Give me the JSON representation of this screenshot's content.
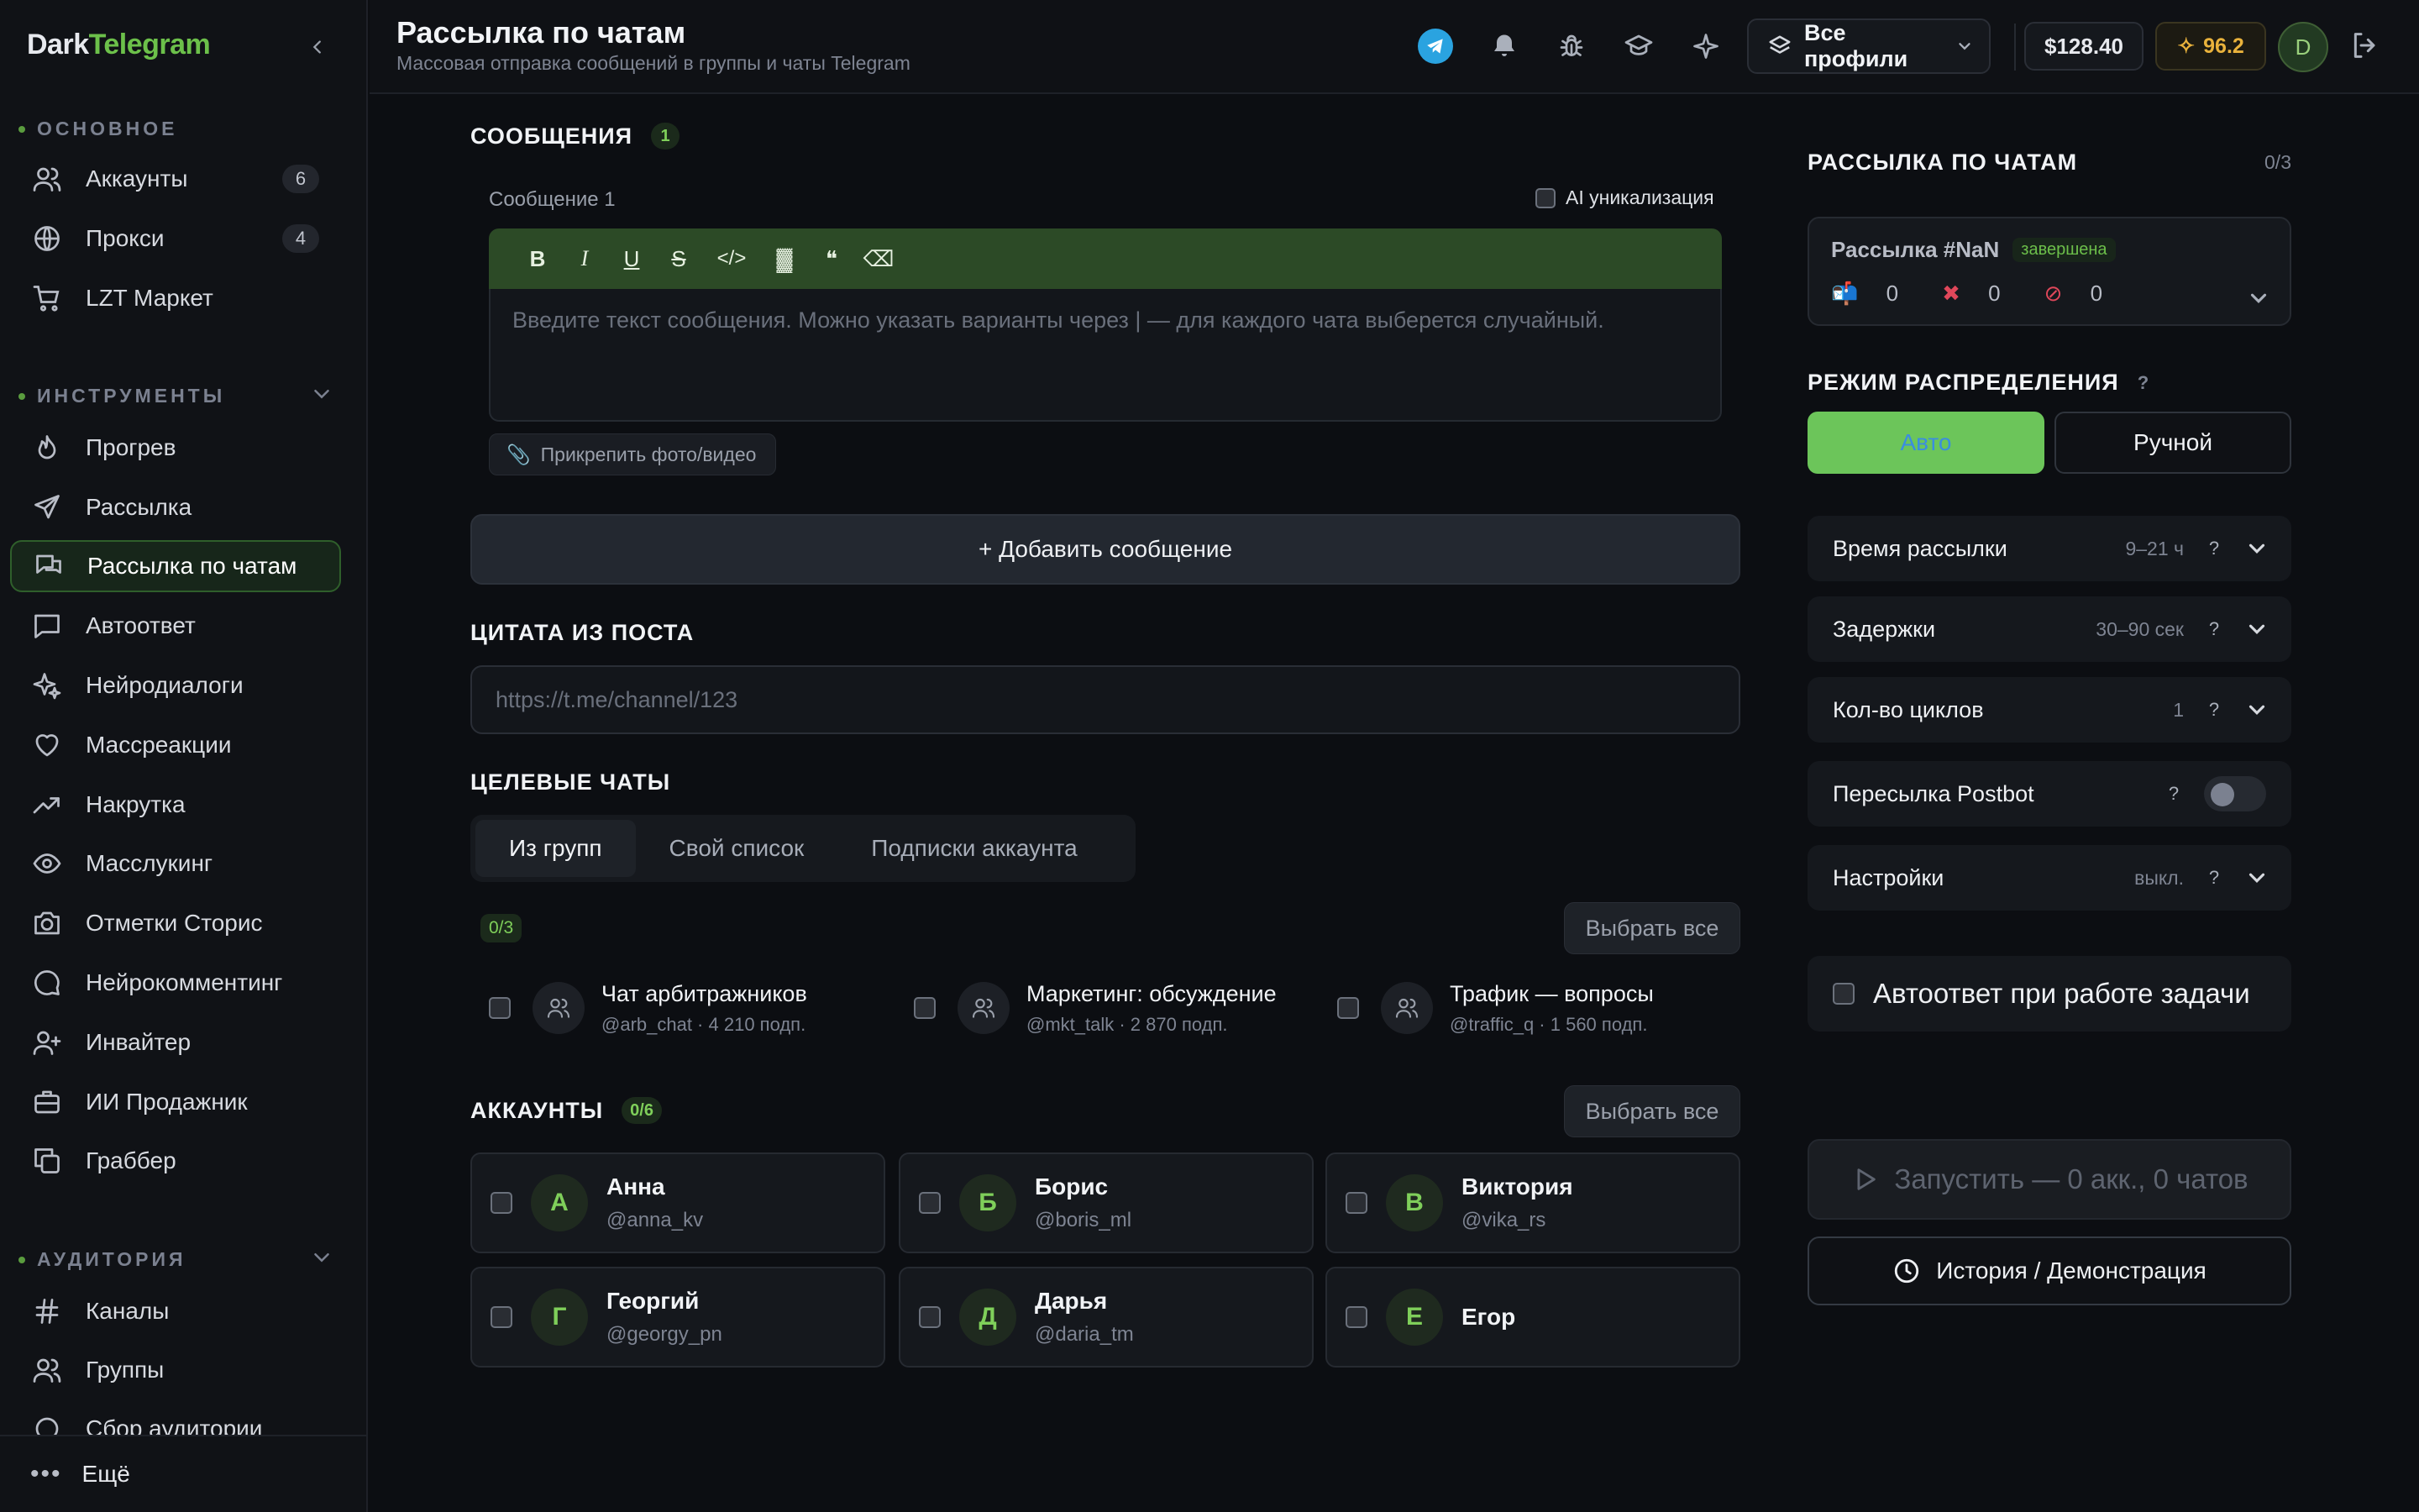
{
  "sidebar": {
    "logo": {
      "part1": "Dark",
      "part2": "Telegram"
    },
    "sections": {
      "main": "ОСНОВНОЕ",
      "tools": "ИНСТРУМЕНТЫ",
      "audience": "АУДИТОРИЯ"
    },
    "items": [
      {
        "label": "Аккаунты",
        "icon": "users-icon",
        "badge": "6"
      },
      {
        "label": "Прокси",
        "icon": "globe-icon",
        "badge": "4"
      },
      {
        "label": "LZT Маркет",
        "icon": "cart-icon"
      },
      {
        "label": "Прогрев",
        "icon": "flame-icon"
      },
      {
        "label": "Рассылка",
        "icon": "send-icon"
      },
      {
        "label": "Рассылка по чатам",
        "icon": "chats-icon",
        "active": true
      },
      {
        "label": "Автоответ",
        "icon": "message-square-icon"
      },
      {
        "label": "Нейродиалоги",
        "icon": "sparkles-icon"
      },
      {
        "label": "Массреакции",
        "icon": "heart-icon"
      },
      {
        "label": "Накрутка",
        "icon": "trending-up-icon"
      },
      {
        "label": "Масслукинг",
        "icon": "eye-icon"
      },
      {
        "label": "Отметки Сторис",
        "icon": "camera-icon"
      },
      {
        "label": "Нейрокомментинг",
        "icon": "message-circle-icon"
      },
      {
        "label": "Инвайтер",
        "icon": "user-plus-icon"
      },
      {
        "label": "ИИ Продажник",
        "icon": "briefcase-icon"
      },
      {
        "label": "Граббер",
        "icon": "copy-icon"
      },
      {
        "label": "Каналы",
        "icon": "hash-icon"
      },
      {
        "label": "Группы",
        "icon": "users-icon"
      },
      {
        "label": "Сбор аудитории",
        "icon": "circle-icon"
      }
    ],
    "more": "Ещё"
  },
  "header": {
    "title": "Рассылка по чатам",
    "subtitle": "Массовая отправка сообщений в группы и чаты Telegram",
    "profiles": "Все профили",
    "balance": "$128.40",
    "stars": "96.2",
    "avatar": "D"
  },
  "messages": {
    "heading": "СООБЩЕНИЯ",
    "count": "1",
    "message_label": "Сообщение 1",
    "ai_label": "AI уникализация",
    "toolbar": [
      "B",
      "I",
      "U",
      "S",
      "</>",
      "▓",
      "❝",
      "⌫"
    ],
    "placeholder": "Введите текст сообщения. Можно указать варианты через | — для каждого чата выберется случайный.",
    "attach": "Прикрепить фото/видео",
    "add_message": "+ Добавить сообщение"
  },
  "quote": {
    "heading": "ЦИТАТА ИЗ ПОСТА",
    "placeholder": "https://t.me/channel/123"
  },
  "targets": {
    "heading": "ЦЕЛЕВЫЕ ЧАТЫ",
    "tabs": [
      "Из групп",
      "Свой список",
      "Подписки аккаунта"
    ],
    "selected": "0/3",
    "select_all": "Выбрать все",
    "chats": [
      {
        "name": "Чат арбитражников",
        "sub": "@arb_chat · 4 210 подп."
      },
      {
        "name": "Маркетинг: обсуждение",
        "sub": "@mkt_talk · 2 870 подп."
      },
      {
        "name": "Трафик — вопросы",
        "sub": "@traffic_q · 1 560 подп."
      }
    ]
  },
  "accounts": {
    "heading": "АККАУНТЫ",
    "count": "0/6",
    "select_all": "Выбрать все",
    "list": [
      {
        "initial": "А",
        "name": "Анна",
        "handle": "@anna_kv"
      },
      {
        "initial": "Б",
        "name": "Борис",
        "handle": "@boris_ml"
      },
      {
        "initial": "В",
        "name": "Виктория",
        "handle": "@vika_rs"
      },
      {
        "initial": "Г",
        "name": "Георгий",
        "handle": "@georgy_pn"
      },
      {
        "initial": "Д",
        "name": "Дарья",
        "handle": "@daria_tm"
      },
      {
        "initial": "Е",
        "name": "Егор",
        "handle": ""
      }
    ]
  },
  "panel": {
    "title": "РАССЫЛКА ПО ЧАТАМ",
    "count": "0/3",
    "campaign": {
      "name": "Рассылка #NaN",
      "status": "завершена",
      "sent": "0",
      "failed": "0",
      "blocked": "0"
    },
    "mode_title": "РЕЖИМ РАСПРЕДЕЛЕНИЯ",
    "mode_help": "?",
    "mode_auto": "Авто",
    "mode_manual": "Ручной",
    "rows": [
      {
        "label": "Время рассылки",
        "value": "9–21 ч"
      },
      {
        "label": "Задержки",
        "value": "30–90 сек"
      },
      {
        "label": "Кол-во циклов",
        "value": "1"
      },
      {
        "label": "Пересылка Postbot",
        "value": ""
      },
      {
        "label": "Настройки",
        "value": "выкл."
      }
    ],
    "autoanswer": "Автоответ при работе задачи",
    "run": "Запустить — 0 акк., 0 чатов",
    "history": "История / Демонстрация"
  }
}
